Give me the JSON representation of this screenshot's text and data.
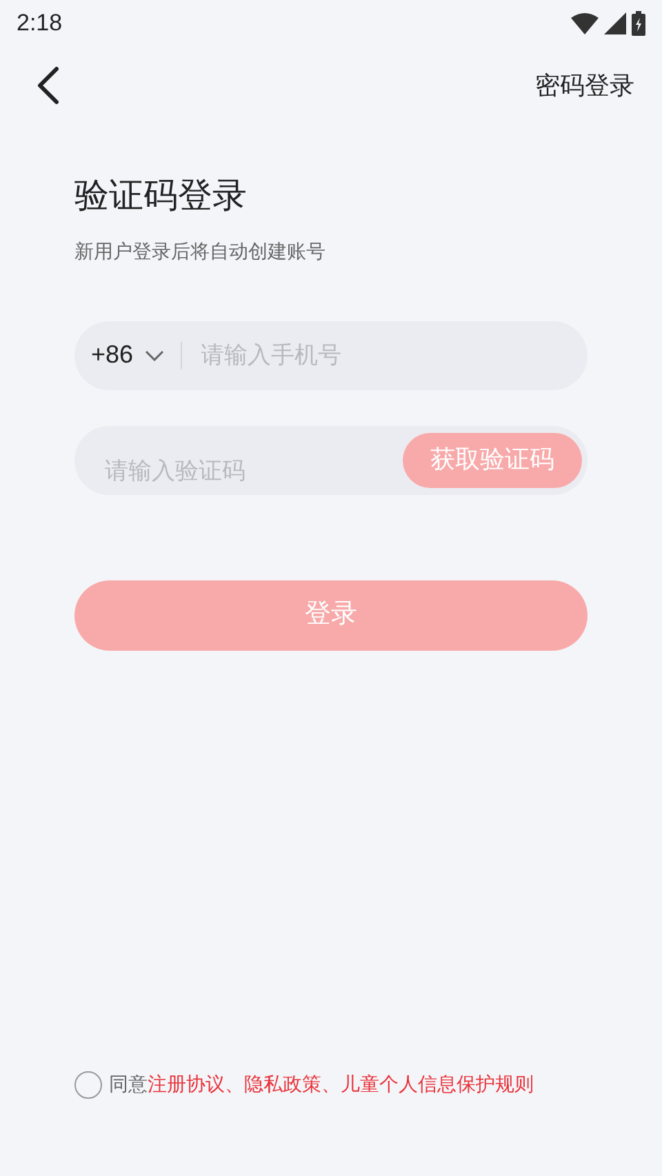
{
  "status_bar": {
    "time": "2:18"
  },
  "header": {
    "link": "密码登录"
  },
  "title": "验证码登录",
  "subtitle": "新用户登录后将自动创建账号",
  "phone_field": {
    "country_code": "+86",
    "placeholder": "请输入手机号"
  },
  "code_field": {
    "placeholder": "请输入验证码",
    "button": "获取验证码"
  },
  "login_button": {
    "label": "登录",
    "disabled": true
  },
  "agreement": {
    "checked": false,
    "prefix": "同意",
    "links": "注册协议、隐私政策、儿童个人信息保护规则"
  }
}
